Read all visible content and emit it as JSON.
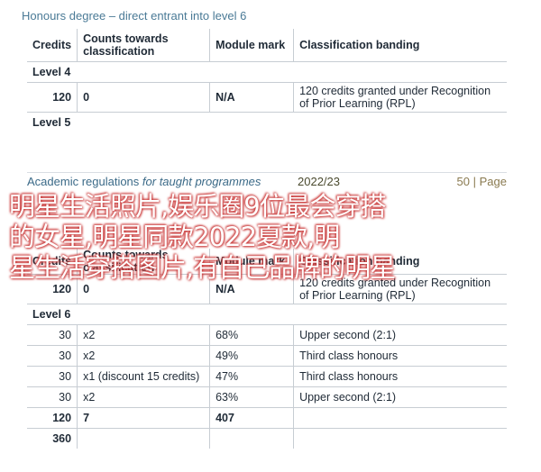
{
  "section1": {
    "title": "Honours degree – direct entrant into level 6",
    "headers": [
      "Credits",
      "Counts towards classification",
      "Module mark",
      "Classification banding"
    ],
    "levels": [
      {
        "label": "Level 4",
        "rows": [
          {
            "credits": "120",
            "counts": "0",
            "mark": "N/A",
            "banding": "120 credits granted under Recognition of Prior Learning (RPL)"
          }
        ]
      },
      {
        "label": "Level 5",
        "rows": []
      }
    ]
  },
  "footer": {
    "left_bold": "Academic regulations",
    "left_italic": " for taught programmes",
    "year": "2022/23",
    "page_num": "50",
    "page_sep": " | ",
    "page_word": "Page"
  },
  "overlay": {
    "line1": "明星生活照片,娱乐圈9位最会穿搭",
    "line2": "的女星,明星同款2022夏款,明",
    "line3": "星生活穿搭图片,有自己品牌的明星"
  },
  "section2": {
    "headers": [
      "Credits",
      "Counts towards classification",
      "Module mark",
      "Classification banding"
    ],
    "level4_row": {
      "credits": "120",
      "counts": "0",
      "mark": "N/A",
      "banding": "120 credits granted under Recognition of Prior Learning (RPL)"
    },
    "level6_label": "Level 6",
    "rows": [
      {
        "credits": "30",
        "counts": "x2",
        "mark": "68%",
        "banding": "Upper second (2:1)"
      },
      {
        "credits": "30",
        "counts": "x2",
        "mark": "49%",
        "banding": "Third class honours"
      },
      {
        "credits": "30",
        "counts": "x1 (discount 15 credits)",
        "mark": "47%",
        "banding": "Third class honours"
      },
      {
        "credits": "30",
        "counts": "x2",
        "mark": "63%",
        "banding": "Upper second (2:1)"
      }
    ],
    "total_row": {
      "credits": "120",
      "counts": "7",
      "mark": "407"
    },
    "grand_total": "360"
  }
}
